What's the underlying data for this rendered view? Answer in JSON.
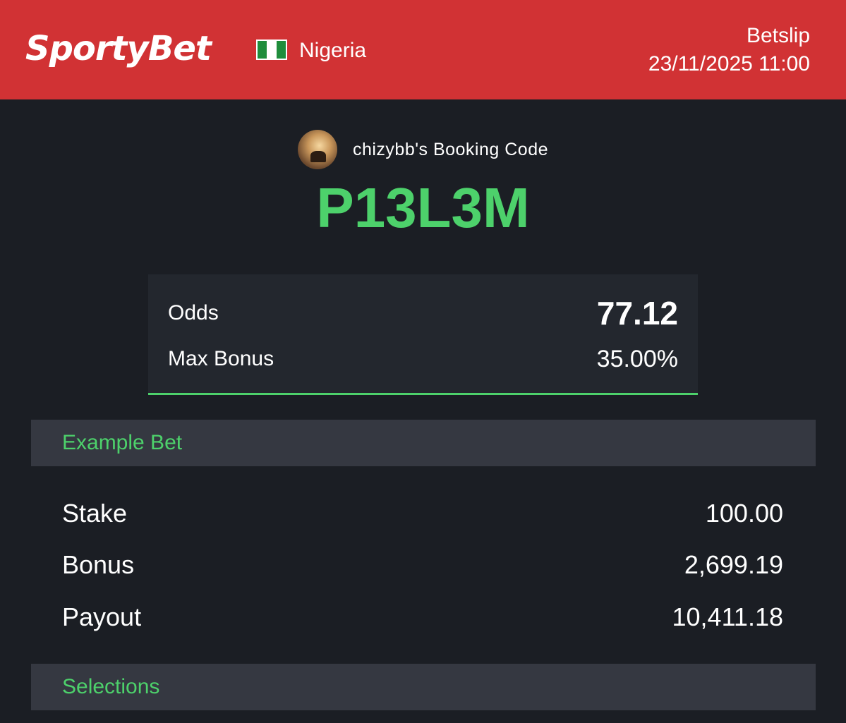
{
  "header": {
    "brand": "SportyBet",
    "country": "Nigeria",
    "page_title": "Betslip",
    "datetime": "23/11/2025 11:00",
    "colors": {
      "background": "#d13234",
      "flag_green": "#1f8d3c"
    }
  },
  "booking": {
    "label": "chizybb's Booking Code",
    "code": "P13L3M",
    "accent": "#4dd16b"
  },
  "summary": {
    "odds_label": "Odds",
    "odds_value": "77.12",
    "max_bonus_label": "Max Bonus",
    "max_bonus_value": "35.00%"
  },
  "example_bet": {
    "title": "Example Bet",
    "rows": [
      {
        "label": "Stake",
        "value": "100.00"
      },
      {
        "label": "Bonus",
        "value": "2,699.19"
      },
      {
        "label": "Payout",
        "value": "10,411.18"
      }
    ]
  },
  "selections": {
    "title": "Selections"
  }
}
